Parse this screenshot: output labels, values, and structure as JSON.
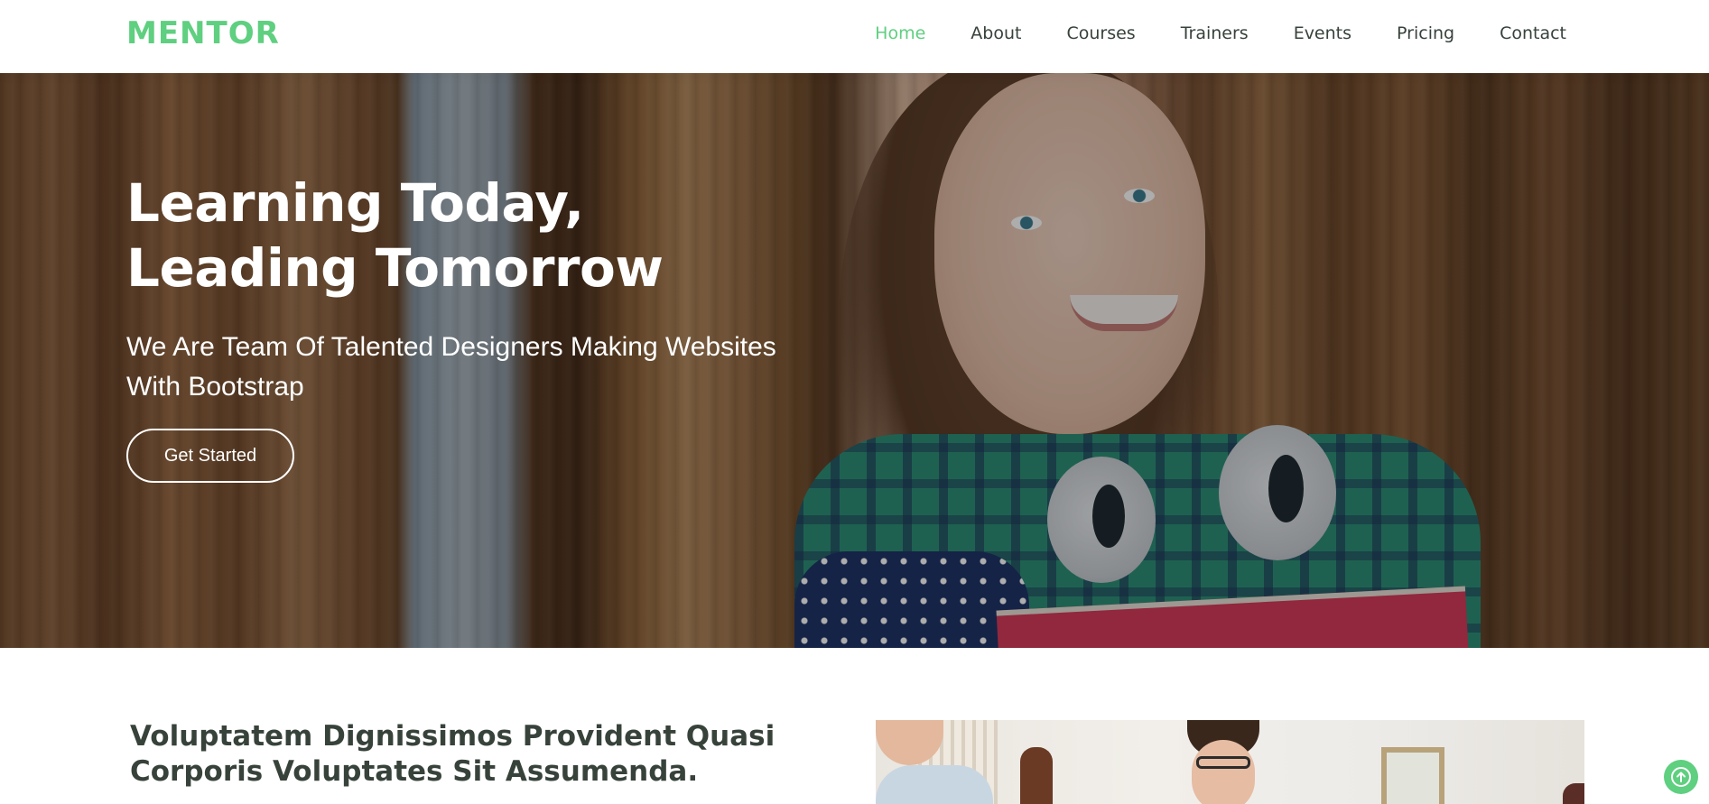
{
  "brand": {
    "logo_text": "MENTOR",
    "accent_color": "#5fcf80",
    "text_color": "#37423b"
  },
  "nav": {
    "items": [
      {
        "label": "Home",
        "active": true
      },
      {
        "label": "About",
        "active": false
      },
      {
        "label": "Courses",
        "active": false
      },
      {
        "label": "Trainers",
        "active": false
      },
      {
        "label": "Events",
        "active": false
      },
      {
        "label": "Pricing",
        "active": false
      },
      {
        "label": "Contact",
        "active": false
      }
    ]
  },
  "hero": {
    "title_line1": "Learning Today,",
    "title_line2": "Leading Tomorrow",
    "subtitle": "We Are Team Of Talented Designers Making Websites With Bootstrap",
    "cta_label": "Get Started"
  },
  "about": {
    "title": "Voluptatem Dignissimos Provident Quasi Corporis Voluptates Sit Assumenda."
  },
  "back_to_top": {
    "icon": "arrow-up-icon"
  }
}
